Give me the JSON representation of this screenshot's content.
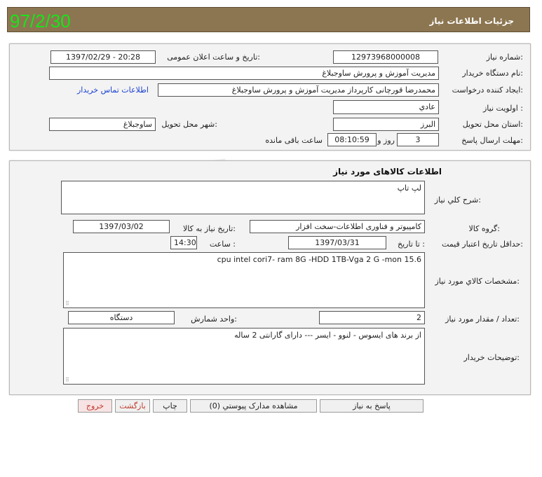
{
  "header": {
    "title": "جزئیات اطلاعات نیاز",
    "date_stamp": "97/2/30"
  },
  "info": {
    "need_number_label": "شماره نیاز:",
    "need_number": "12973968000008",
    "announce_label": "تاریخ و ساعت اعلان عمومی:",
    "announce_value": "1397/02/29 - 20:28",
    "buyer_label": "نام دستگاه خریدار:",
    "buyer_value": "مدیریت آموزش و پرورش ساوجبلاغ",
    "creator_label": "ایجاد کننده درخواست:",
    "creator_value": "محمدرضا قورچانی کارپرداز مدیریت آموزش و پرورش ساوجبلاغ",
    "contact_link": "اطلاعات تماس خریدار",
    "priority_label": "اولویت نیاز :",
    "priority_value": "عادي",
    "province_label": "استان محل تحویل:",
    "province_value": "البرز",
    "city_label": "شهر محل تحویل:",
    "city_value": "ساوجبلاغ",
    "deadline_label": "مهلت ارسال پاسخ:",
    "days_value": "3",
    "days_unit": "روز و",
    "time_value": "08:10:59",
    "time_unit": "ساعت باقی مانده"
  },
  "goods": {
    "section_title": "اطلاعات کالاهای مورد نیاز",
    "desc_label": "شرح کلي نیاز:",
    "desc_value": "لپ تاپ",
    "group_label": "گروه کالا:",
    "group_value": "کامپیوتر و فناوری اطلاعات-سخت افزار",
    "need_date_label": "تاریخ نیاز به کالا:",
    "need_date_value": "1397/03/02",
    "validity_label": "حداقل تاریخ اعتبار قیمت:",
    "until_label": "تا تاریخ :",
    "until_value": "1397/03/31",
    "hour_label": "ساعت :",
    "hour_value": "14:30",
    "specs_label": "مشخصات کالاي مورد نیاز:",
    "specs_value": "cpu intel cori7- ram 8G -HDD 1TB-Vga 2 G -mon 15.6",
    "qty_label": "تعداد / مقدار مورد نیاز:",
    "qty_value": "2",
    "unit_label": "واحد شمارش:",
    "unit_value": "دستگاه",
    "buyer_notes_label": "توضیحات خریدار:",
    "buyer_notes_value": "از برند های ایسوس - لنوو - ایسر --- دارای گارانتی 2 ساله"
  },
  "actions": {
    "reply": "پاسخ به نیاز",
    "attachments": "مشاهده مدارک پیوستي (0)",
    "print": "چاپ",
    "back": "بازگشت",
    "exit": "خروج"
  },
  "colors": {
    "header_bg": "#8c7651",
    "date_green": "#19e419",
    "link_blue": "#1a3fd0"
  }
}
